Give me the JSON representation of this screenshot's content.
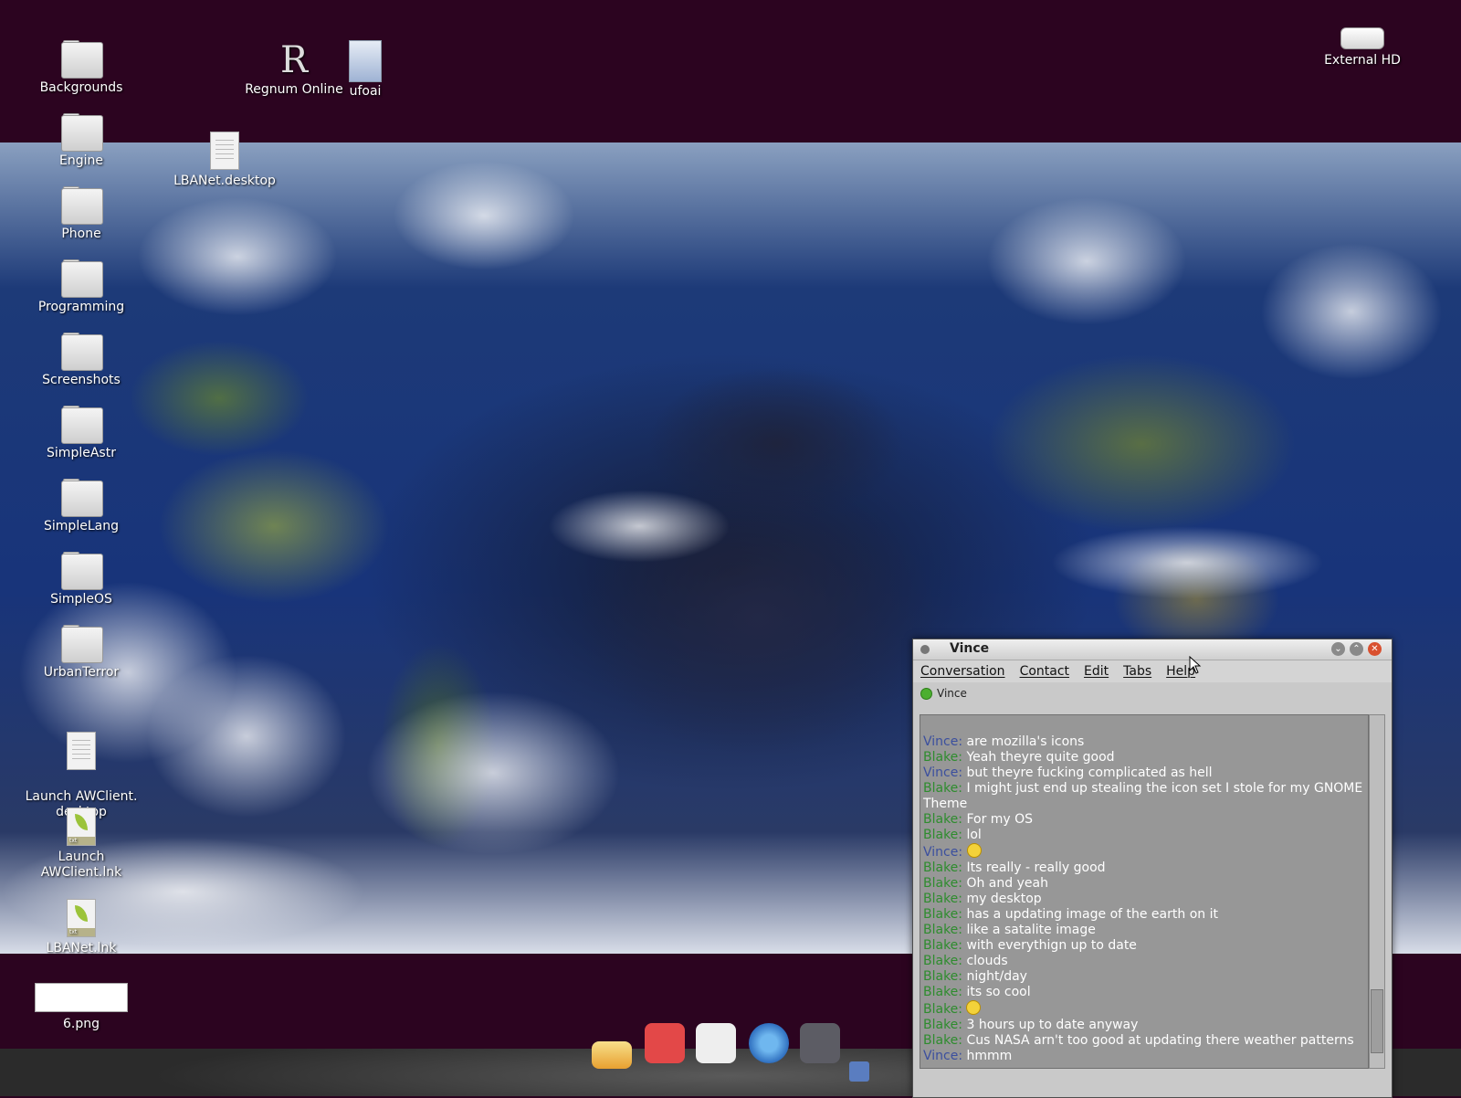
{
  "desktop": {
    "icons": [
      {
        "label": "Backgrounds",
        "icon": "folder-icon"
      },
      {
        "label": "Engine",
        "icon": "folder-icon"
      },
      {
        "label": "Phone",
        "icon": "folder-icon"
      },
      {
        "label": "Programming",
        "icon": "folder-icon"
      },
      {
        "label": "Screenshots",
        "icon": "folder-icon"
      },
      {
        "label": "SimpleAstr",
        "icon": "folder-icon"
      },
      {
        "label": "SimpleLang",
        "icon": "folder-icon"
      },
      {
        "label": "SimpleOS",
        "icon": "folder-icon"
      },
      {
        "label": "UrbanTerror",
        "icon": "folder-icon"
      },
      {
        "label": "Launch AWClient.\ndesktop",
        "icon": "document-icon"
      },
      {
        "label": "Launch AWClient.lnk",
        "icon": "text-file-icon"
      },
      {
        "label": "LBANet.lnk",
        "icon": "text-file-icon"
      },
      {
        "label": "6.png",
        "icon": "image-icon"
      },
      {
        "label": "LBANet.desktop",
        "icon": "document-icon"
      },
      {
        "label": "Regnum Online",
        "icon": "regnum-icon"
      },
      {
        "label": "ufoai",
        "icon": "shell-script-icon"
      },
      {
        "label": "External HD",
        "icon": "drive-icon"
      }
    ]
  },
  "chat": {
    "title": "Vince",
    "menu": [
      "Conversation",
      "Contact",
      "Edit",
      "Tabs",
      "Help"
    ],
    "contact": "Vince",
    "messages": [
      {
        "who": "Vince:",
        "text": "are mozilla's icons"
      },
      {
        "who": "Blake:",
        "text": "Yeah theyre quite good"
      },
      {
        "who": "Vince:",
        "text": "but theyre fucking complicated as hell"
      },
      {
        "who": "Blake:",
        "text": "I might just end up stealing the icon set I stole for my GNOME Theme"
      },
      {
        "who": "Blake:",
        "text": "For my OS"
      },
      {
        "who": "Blake:",
        "text": "lol"
      },
      {
        "who": "Vince:",
        "text": "",
        "emoticon": "tongue-smiley"
      },
      {
        "who": "Blake:",
        "text": "Its really - really good"
      },
      {
        "who": "Blake:",
        "text": "Oh and yeah"
      },
      {
        "who": "Blake:",
        "text": "my desktop"
      },
      {
        "who": "Blake:",
        "text": "has a updating image of the earth on it"
      },
      {
        "who": "Blake:",
        "text": "like a satalite image"
      },
      {
        "who": "Blake:",
        "text": "with everythign up to date"
      },
      {
        "who": "Blake:",
        "text": "clouds"
      },
      {
        "who": "Blake:",
        "text": "night/day"
      },
      {
        "who": "Blake:",
        "text": "its so cool"
      },
      {
        "who": "Blake:",
        "text": "",
        "emoticon": "grin-smiley"
      },
      {
        "who": "Blake:",
        "text": "3 hours up to date anyway"
      },
      {
        "who": "Blake:",
        "text": "Cus NASA arn't too good at updating there weather patterns"
      },
      {
        "who": "Vince:",
        "text": "hmmm"
      }
    ]
  },
  "dock": {
    "items": [
      "mail-icon",
      "home-icon",
      "text-editor-icon",
      "chromium-icon",
      "gnome-foot-icon",
      "network-icon"
    ]
  },
  "colors": {
    "desktop_bg": "#2c0420",
    "vince_name": "#3b4f9e",
    "blake_name": "#2e8c2e"
  }
}
